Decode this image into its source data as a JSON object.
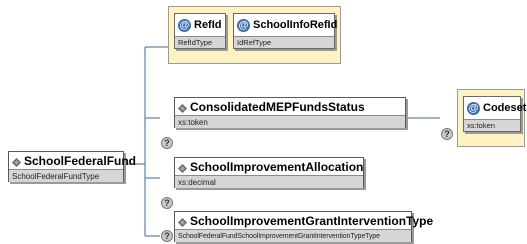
{
  "colors": {
    "line": "#3a6ea5",
    "attribute_group_fill": "#fff3c2",
    "type_bar": "#d6d6d6",
    "element_icon_blue": "#3a6fb5",
    "element_icon_orange": "#e89a2c"
  },
  "root": {
    "name": "SchoolFederalFund",
    "type": "SchoolFederalFundType"
  },
  "attributes": [
    {
      "name": "RefId",
      "type": "RefIdType"
    },
    {
      "name": "SchoolInfoRefId",
      "type": "IdRefType"
    }
  ],
  "children": [
    {
      "name": "ConsolidatedMEPFundsStatus",
      "type": "xs:token",
      "optional_marker": "?",
      "attribute": {
        "name": "Codeset",
        "type": "xs:token",
        "optional_marker": "?"
      }
    },
    {
      "name": "SchoolImprovementAllocation",
      "type": "xs:decimal",
      "optional_marker": "?"
    },
    {
      "name": "SchoolImprovementGrantInterventionType",
      "type": "SchoolFederalFundSchoolImprovementGrantInterventionTypeType",
      "optional_marker": "?"
    }
  ],
  "icons": {
    "element": "element-diamond-icon",
    "attribute": "at-sign-icon",
    "optional": "question-mark-icon"
  }
}
